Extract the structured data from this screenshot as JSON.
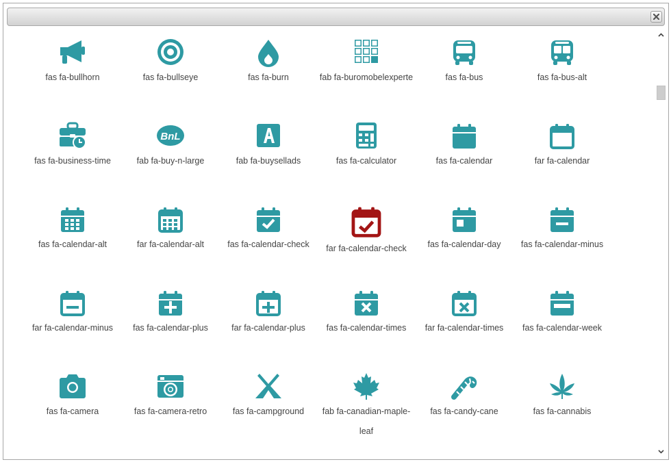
{
  "dialog": {
    "close_icon": "close-icon",
    "accent_color": "#2e9aa3",
    "selected_color": "#a31515"
  },
  "icons": [
    {
      "name": "fas fa-bullhorn",
      "icon": "bullhorn-icon"
    },
    {
      "name": "fas fa-bullseye",
      "icon": "bullseye-icon"
    },
    {
      "name": "fas fa-burn",
      "icon": "burn-icon"
    },
    {
      "name": "fab fa-buromobelexperte",
      "icon": "buromobelexperte-icon"
    },
    {
      "name": "fas fa-bus",
      "icon": "bus-icon"
    },
    {
      "name": "fas fa-bus-alt",
      "icon": "bus-alt-icon"
    },
    {
      "name": "fas fa-business-time",
      "icon": "business-time-icon"
    },
    {
      "name": "fab fa-buy-n-large",
      "icon": "buy-n-large-icon"
    },
    {
      "name": "fab fa-buysellads",
      "icon": "buysellads-icon"
    },
    {
      "name": "fas fa-calculator",
      "icon": "calculator-icon"
    },
    {
      "name": "fas fa-calendar",
      "icon": "calendar-icon"
    },
    {
      "name": "far fa-calendar",
      "icon": "calendar-outline-icon"
    },
    {
      "name": "fas fa-calendar-alt",
      "icon": "calendar-alt-icon"
    },
    {
      "name": "far fa-calendar-alt",
      "icon": "calendar-alt-outline-icon"
    },
    {
      "name": "fas fa-calendar-check",
      "icon": "calendar-check-icon"
    },
    {
      "name": "far fa-calendar-check",
      "icon": "calendar-check-outline-icon",
      "selected": true
    },
    {
      "name": "fas fa-calendar-day",
      "icon": "calendar-day-icon"
    },
    {
      "name": "fas fa-calendar-minus",
      "icon": "calendar-minus-icon"
    },
    {
      "name": "far fa-calendar-minus",
      "icon": "calendar-minus-outline-icon"
    },
    {
      "name": "fas fa-calendar-plus",
      "icon": "calendar-plus-icon"
    },
    {
      "name": "far fa-calendar-plus",
      "icon": "calendar-plus-outline-icon"
    },
    {
      "name": "fas fa-calendar-times",
      "icon": "calendar-times-icon"
    },
    {
      "name": "far fa-calendar-times",
      "icon": "calendar-times-outline-icon"
    },
    {
      "name": "fas fa-calendar-week",
      "icon": "calendar-week-icon"
    },
    {
      "name": "fas fa-camera",
      "icon": "camera-icon"
    },
    {
      "name": "fas fa-camera-retro",
      "icon": "camera-retro-icon"
    },
    {
      "name": "fas fa-campground",
      "icon": "campground-icon"
    },
    {
      "name": "fab fa-canadian-maple-leaf",
      "icon": "canadian-maple-leaf-icon",
      "label_lines": [
        "fab fa-canadian-maple-",
        "leaf"
      ]
    },
    {
      "name": "fas fa-candy-cane",
      "icon": "candy-cane-icon"
    },
    {
      "name": "fas fa-cannabis",
      "icon": "cannabis-icon"
    }
  ]
}
